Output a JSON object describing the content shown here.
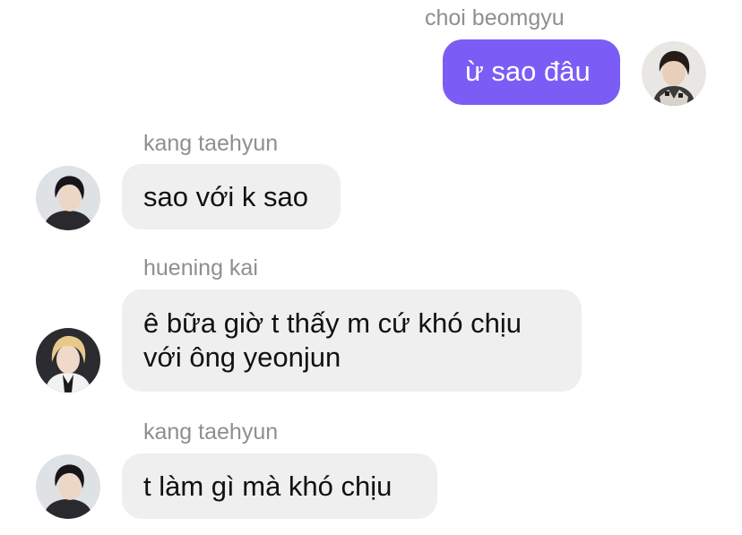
{
  "messages": [
    {
      "sender": "choi beomgyu",
      "text": "ừ sao đâu",
      "direction": "outgoing",
      "avatar_icon": "user-avatar-icon"
    },
    {
      "sender": "kang taehyun",
      "text": "sao với k sao",
      "direction": "incoming",
      "avatar_icon": "user-avatar-icon"
    },
    {
      "sender": "huening kai",
      "lines": [
        "ê bữa giờ t thấy m cứ khó chịu",
        "với ông yeonjun"
      ],
      "direction": "incoming",
      "avatar_icon": "user-avatar-icon"
    },
    {
      "sender": "kang taehyun",
      "text": "t làm gì mà khó chịu",
      "direction": "incoming",
      "avatar_icon": "user-avatar-icon"
    }
  ],
  "colors": {
    "outgoing_bubble": "#7b5cf5",
    "incoming_bubble": "#efeff0",
    "sender_name": "#8e8e93"
  }
}
